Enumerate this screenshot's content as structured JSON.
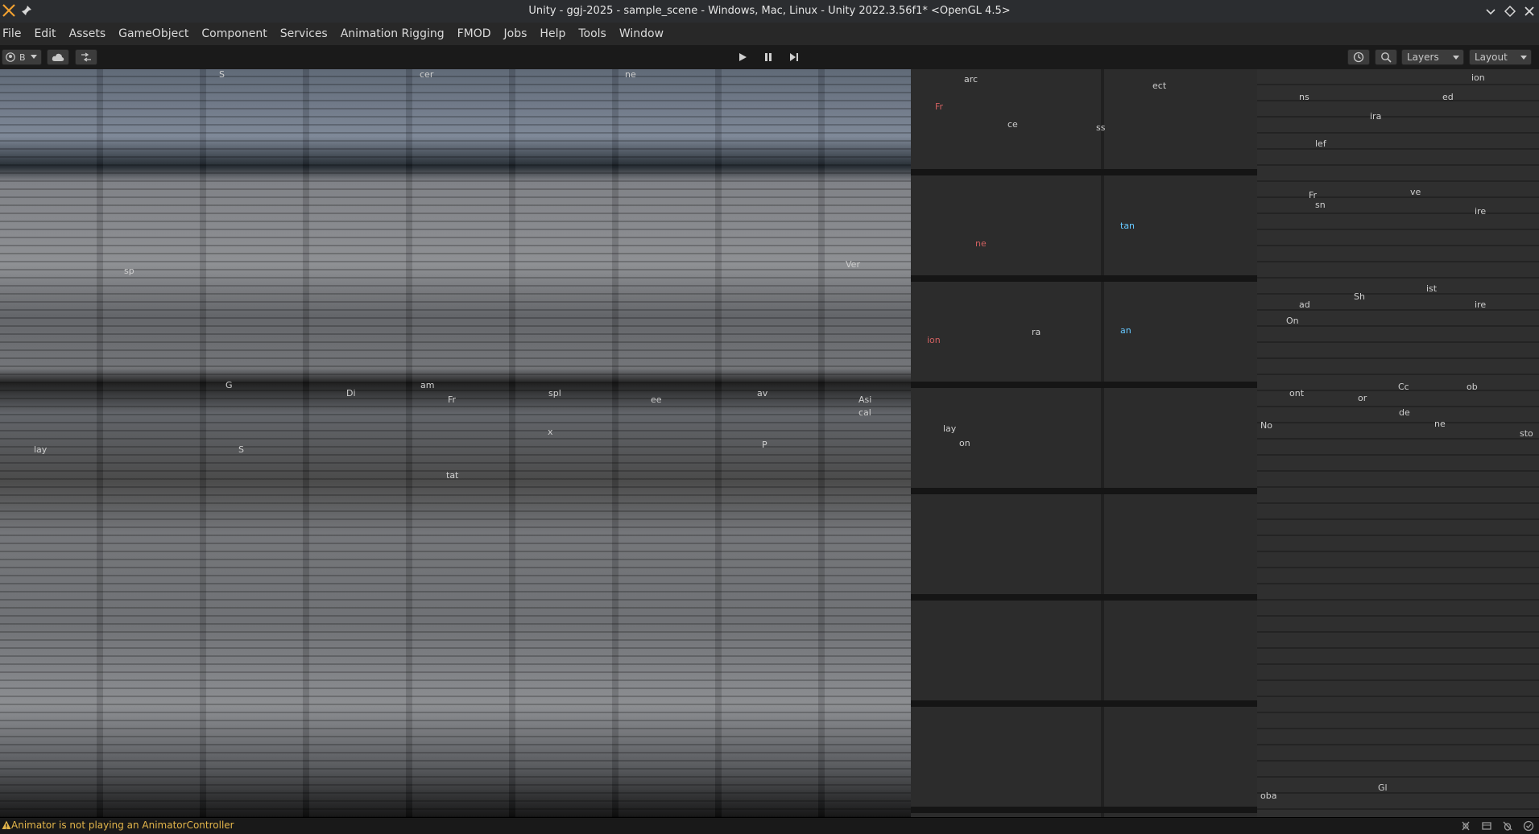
{
  "window": {
    "title": "Unity - ggj-2025 - sample_scene - Windows, Mac, Linux - Unity 2022.3.56f1* <OpenGL 4.5>"
  },
  "menu": [
    "File",
    "Edit",
    "Assets",
    "GameObject",
    "Component",
    "Services",
    "Animation Rigging",
    "FMOD",
    "Jobs",
    "Help",
    "Tools",
    "Window"
  ],
  "toolbar": {
    "account_label": "B",
    "layers_label": "Layers",
    "layout_label": "Layout"
  },
  "fragments": {
    "scene": [
      "S",
      "cer",
      "ne",
      "G",
      "am",
      "Di",
      "Fr",
      "spl",
      "ee",
      "av",
      "Asi",
      "cal",
      "lay",
      "x",
      "S",
      "P",
      "tat",
      "sp",
      "Ver"
    ],
    "anim": [
      "arc",
      "ect",
      "Fr",
      "ce",
      "tan",
      "ne",
      "ra",
      "ion",
      "an",
      "lay",
      "on",
      "ss"
    ],
    "inspector": [
      "ion",
      "ns",
      "ira",
      "ed",
      "lef",
      "ve",
      "ire",
      "Fr",
      "sn",
      "ist",
      "ire",
      "Sh",
      "ad",
      "On",
      "ont",
      "or",
      "Cc",
      "ob",
      "de",
      "ne",
      "sto",
      "No",
      "Gl",
      "oba"
    ]
  },
  "status": {
    "message": "Animator is not playing an AnimatorController"
  },
  "colors": {
    "titlebar": "#2b2d30",
    "menubar": "#282828",
    "toolbar": "#1a1a1a",
    "warning": "#e3b54a",
    "accent_red": "#d06060",
    "accent_cyan": "#66c8ff"
  }
}
